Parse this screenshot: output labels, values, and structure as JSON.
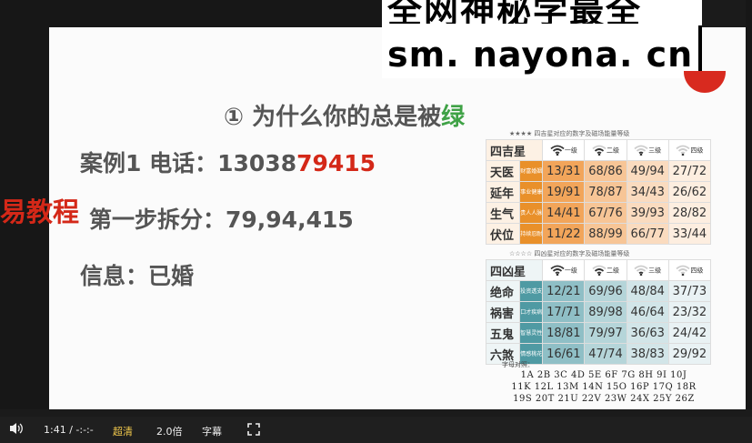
{
  "watermark": {
    "line1": "全网神秘学最全",
    "line2": "sm. nayona. cn"
  },
  "left_tag": "易教程",
  "slide": {
    "title_prefix": "① 为什么你的总是被",
    "title_highlight": "绿",
    "case_label": "案例1 电话：",
    "case_number_plain": "13038",
    "case_number_red": "79415",
    "step_text": "第一步拆分：79,94,415",
    "info_text": "信息：已婚"
  },
  "good_table": {
    "caption": "★★★★ 四吉星对应的数字及磁场能量等级",
    "header": "四吉星",
    "levels": [
      "一级",
      "二级",
      "三级",
      "四级"
    ],
    "rows": [
      {
        "name": "天医",
        "sub": "财富婚姻",
        "values": [
          "13/31",
          "68/86",
          "49/94",
          "27/72"
        ]
      },
      {
        "name": "延年",
        "sub": "事业健康",
        "values": [
          "19/91",
          "78/87",
          "34/43",
          "26/62"
        ]
      },
      {
        "name": "生气",
        "sub": "贵人人脉",
        "values": [
          "14/41",
          "67/76",
          "39/93",
          "28/82"
        ]
      },
      {
        "name": "伏位",
        "sub": "持续忍耐",
        "values": [
          "11/22",
          "88/99",
          "66/77",
          "33/44"
        ]
      }
    ]
  },
  "bad_table": {
    "caption": "☆☆☆☆ 四凶星对应的数字及磁场能量等级",
    "header": "四凶星",
    "levels": [
      "一级",
      "二级",
      "三级",
      "四级"
    ],
    "rows": [
      {
        "name": "绝命",
        "sub": "投资透支",
        "values": [
          "12/21",
          "69/96",
          "48/84",
          "37/73"
        ]
      },
      {
        "name": "祸害",
        "sub": "口才疾病",
        "values": [
          "17/71",
          "89/98",
          "46/64",
          "23/32"
        ]
      },
      {
        "name": "五鬼",
        "sub": "智慧灵性",
        "values": [
          "18/81",
          "79/97",
          "36/63",
          "24/42"
        ]
      },
      {
        "name": "六煞",
        "sub": "情感桃花",
        "values": [
          "16/61",
          "47/74",
          "38/83",
          "29/92"
        ]
      }
    ]
  },
  "letters": {
    "label": "字母对照：",
    "rows": [
      "1A 2B 3C 4D 5E 6F 7G 8H 9I 10J",
      "11K 12L 13M 14N 15O 16P 17Q 18R",
      "19S 20T 21U 22V 23W 24X 25Y 26Z"
    ]
  },
  "player": {
    "volume_icon": "speaker-icon",
    "time": "1:41 / -:-:-",
    "quality": "超清",
    "speed": "2.0倍",
    "subtitle": "字幕",
    "fullscreen_icon": "fullscreen-icon"
  },
  "colors": {
    "good_accent": "#e9902a",
    "bad_accent": "#4f9aa3",
    "highlight_red": "#d42818",
    "highlight_green": "#3fa246"
  }
}
